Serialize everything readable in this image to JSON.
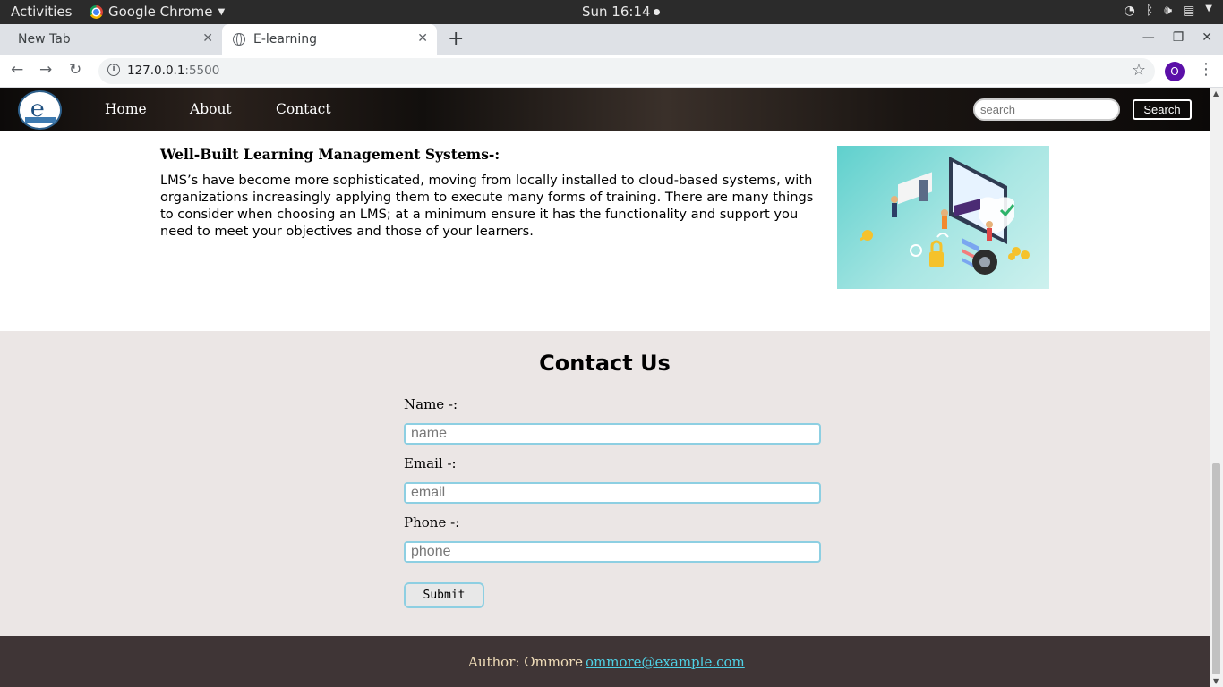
{
  "system_bar": {
    "activities": "Activities",
    "app_name": "Google Chrome",
    "clock": "Sun 16:14"
  },
  "browser": {
    "tabs": [
      {
        "title": "New Tab",
        "active": false
      },
      {
        "title": "E-learning",
        "active": true
      }
    ],
    "url_host": "127.0.0.1",
    "url_port": ":5500",
    "profile_initial": "O"
  },
  "site_nav": {
    "links": [
      "Home",
      "About",
      "Contact"
    ],
    "search_placeholder": "search",
    "search_button": "Search"
  },
  "article": {
    "title": "Well-Built Learning Management Systems-:",
    "body": "LMS’s have become more sophisticated, moving from locally installed to cloud-based systems, with organizations increasingly applying them to execute many forms of training. There are many things to consider when choosing an LMS; at a minimum ensure it has the functionality and support you need to meet your objectives and those of your learners."
  },
  "contact": {
    "title": "Contact Us",
    "fields": [
      {
        "label": "Name -:",
        "placeholder": "name"
      },
      {
        "label": "Email -:",
        "placeholder": "email"
      },
      {
        "label": "Phone -:",
        "placeholder": "phone"
      }
    ],
    "submit": "Submit"
  },
  "footer": {
    "author": "Author: Ommore",
    "email": "ommore@example.com"
  },
  "colors": {
    "contact_bg": "#ebe6e5",
    "footer_bg": "#3f3536",
    "input_border": "#8dcfe2",
    "link_color": "#4fd1e5"
  }
}
